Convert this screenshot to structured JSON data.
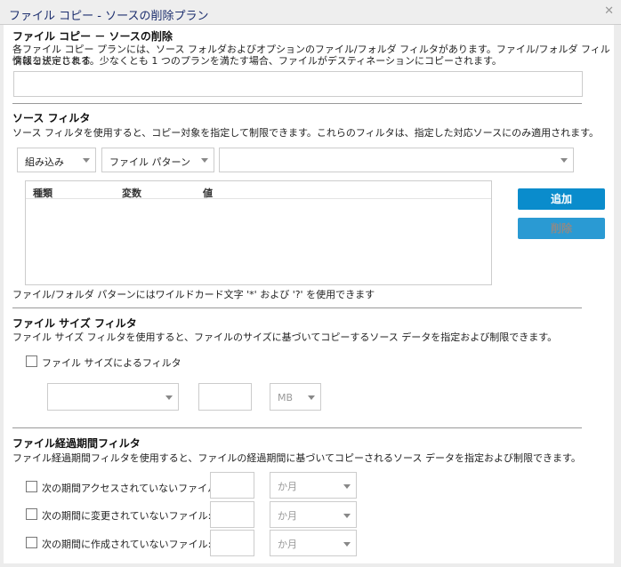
{
  "window": {
    "title": "ファイル コピー - ソースの削除プラン",
    "close_icon": "close-icon"
  },
  "header": {
    "title": "ファイル コピー － ソースの削除",
    "desc1": "各ファイル コピー プランには、ソース フォルダおよびオプションのファイル/フォルダ フィルタがあります。ファイル/フォルダ フィルタはコピーされる",
    "desc2": "情報を決定します。少なくとも 1 つのプランを満たす場合、ファイルがデスティネーションにコピーされます。"
  },
  "source_filter": {
    "title": "ソース フィルタ",
    "desc": "ソース フィルタを使用すると、コピー対象を指定して制限できます。これらのフィルタは、指定した対応ソースにのみ適用されます。",
    "type_select": "組み込み",
    "pattern_select": "ファイル パターン",
    "value_select": "",
    "columns": [
      "種類",
      "変数",
      "値"
    ],
    "add_label": "追加",
    "delete_label": "削除",
    "note": "ファイル/フォルダ パターンにはワイルドカード文字 '*' および '?' を使用できます"
  },
  "size_filter": {
    "title": "ファイル サイズ フィルタ",
    "desc": "ファイル サイズ フィルタを使用すると、ファイルのサイズに基づいてコピーするソース データを指定および制限できます。",
    "checkbox_label": "ファイル サイズによるフィルタ",
    "checked": false,
    "condition": "",
    "size": "",
    "unit": "MB"
  },
  "age_filter": {
    "title": "ファイル経過期間フィルタ",
    "desc": "ファイル経過期間フィルタを使用すると、ファイルの経過期間に基づいてコピーされるソース データを指定および制限できます。",
    "rows": [
      {
        "label": "次の期間アクセスされていないファイル:",
        "value": "",
        "unit": "か月"
      },
      {
        "label": "次の期間に変更されていないファイル:",
        "value": "",
        "unit": "か月"
      },
      {
        "label": "次の期間に作成されていないファイル:",
        "value": "",
        "unit": "か月"
      }
    ]
  },
  "colors": {
    "title": "#1c2e6e",
    "button": "#0a8ccc"
  }
}
